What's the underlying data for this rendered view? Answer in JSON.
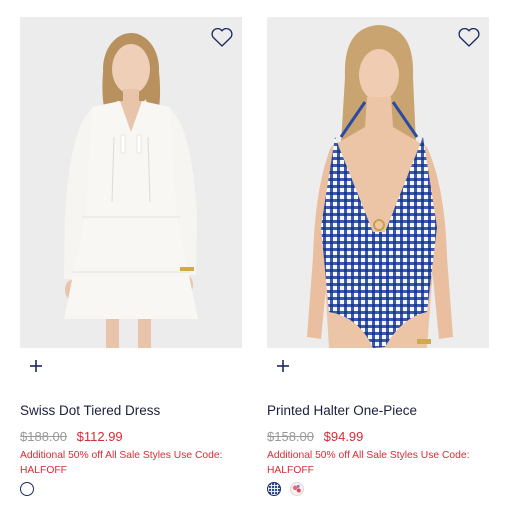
{
  "products": [
    {
      "title": "Swiss Dot Tiered Dress",
      "original_price": "$188.00",
      "sale_price": "$112.99",
      "promo": "Additional 50% off All Sale Styles Use Code: HALFOFF",
      "swatches": [
        "white"
      ]
    },
    {
      "title": "Printed Halter One-Piece",
      "original_price": "$158.00",
      "sale_price": "$94.99",
      "promo": "Additional 50% off All Sale Styles Use Code: HALFOFF",
      "swatches": [
        "blue-gingham",
        "pink-floral"
      ]
    }
  ],
  "icons": {
    "favorite": "heart-outline-icon",
    "add": "plus-icon"
  },
  "colors": {
    "title_text": "#1b1f3b",
    "sale_price": "#d82b37",
    "original_price": "#9a9a9a",
    "promo_text": "#d82b37",
    "icon_navy": "#1b2a5c"
  }
}
